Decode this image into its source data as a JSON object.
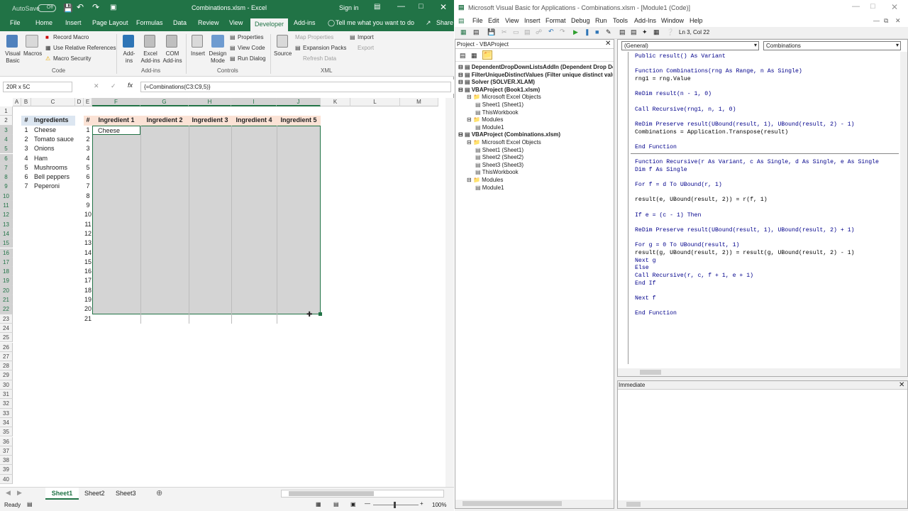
{
  "excel": {
    "autosave_label": "AutoSave",
    "autosave_state": "Off",
    "title": "Combinations.xlsm  -  Excel",
    "signin": "Sign in",
    "tabs": [
      "File",
      "Home",
      "Insert",
      "Page Layout",
      "Formulas",
      "Data",
      "Review",
      "View",
      "Developer",
      "Add-ins"
    ],
    "tell_me": "Tell me what you want to do",
    "share": "Share",
    "ribbon": {
      "visual_basic": "Visual Basic",
      "macros": "Macros",
      "record_macro": "Record Macro",
      "use_relative": "Use Relative References",
      "macro_security": "Macro Security",
      "group_code": "Code",
      "addins": "Add-ins",
      "excel_addins": "Excel Add-ins",
      "com_addins": "COM Add-ins",
      "group_addins": "Add-ins",
      "insert": "Insert",
      "design_mode": "Design Mode",
      "properties": "Properties",
      "view_code": "View Code",
      "run_dialog": "Run Dialog",
      "group_controls": "Controls",
      "source": "Source",
      "map_properties": "Map Properties",
      "expansion_packs": "Expansion Packs",
      "refresh_data": "Refresh Data",
      "import": "Import",
      "export": "Export",
      "group_xml": "XML"
    },
    "name_box": "20R x 5C",
    "formula": "{=Combinations(C3:C9,5)}",
    "columns": [
      "A",
      "B",
      "C",
      "D",
      "E",
      "F",
      "G",
      "H",
      "I",
      "J",
      "K",
      "L",
      "M"
    ],
    "ingredients_header": {
      "num": "#",
      "name": "Ingredients"
    },
    "ingredients": [
      {
        "num": "1",
        "name": "Cheese"
      },
      {
        "num": "2",
        "name": "Tomato sauce"
      },
      {
        "num": "3",
        "name": "Onions"
      },
      {
        "num": "4",
        "name": "Ham"
      },
      {
        "num": "5",
        "name": "Mushrooms"
      },
      {
        "num": "6",
        "name": "Bell peppers"
      },
      {
        "num": "7",
        "name": "Peperoni"
      }
    ],
    "combo_headers": [
      "#",
      "Ingredient 1",
      "Ingredient 2",
      "Ingredient 3",
      "Ingredient 4",
      "Ingredient 5"
    ],
    "combo_rows": [
      "1",
      "2",
      "3",
      "4",
      "5",
      "6",
      "7",
      "8",
      "9",
      "10",
      "11",
      "12",
      "13",
      "14",
      "15",
      "16",
      "17",
      "18",
      "19",
      "20",
      "21"
    ],
    "first_cell": "Cheese",
    "sheets": [
      "Sheet1",
      "Sheet2",
      "Sheet3"
    ],
    "status": "Ready",
    "zoom": "100%"
  },
  "vba": {
    "title": "Microsoft Visual Basic for Applications - Combinations.xlsm - [Module1 (Code)]",
    "menu": [
      "File",
      "Edit",
      "View",
      "Insert",
      "Format",
      "Debug",
      "Run",
      "Tools",
      "Add-Ins",
      "Window",
      "Help"
    ],
    "cursor_pos": "Ln 3, Col 22",
    "project_title": "Project - VBAProject",
    "tree": [
      {
        "label": "DependentDropDownListsAddIn (Dependent Drop Do",
        "level": 0,
        "bold": true
      },
      {
        "label": "FilterUniqueDistinctValues (Filter unique distinct valu",
        "level": 0,
        "bold": true
      },
      {
        "label": "Solver (SOLVER.XLAM)",
        "level": 0,
        "bold": true
      },
      {
        "label": "VBAProject (Book1.xlsm)",
        "level": 0,
        "bold": true
      },
      {
        "label": "Microsoft Excel Objects",
        "level": 1,
        "bold": false
      },
      {
        "label": "Sheet1 (Sheet1)",
        "level": 2,
        "bold": false
      },
      {
        "label": "ThisWorkbook",
        "level": 2,
        "bold": false
      },
      {
        "label": "Modules",
        "level": 1,
        "bold": false
      },
      {
        "label": "Module1",
        "level": 2,
        "bold": false
      },
      {
        "label": "VBAProject (Combinations.xlsm)",
        "level": 0,
        "bold": true
      },
      {
        "label": "Microsoft Excel Objects",
        "level": 1,
        "bold": false
      },
      {
        "label": "Sheet1 (Sheet1)",
        "level": 2,
        "bold": false
      },
      {
        "label": "Sheet2 (Sheet2)",
        "level": 2,
        "bold": false
      },
      {
        "label": "Sheet3 (Sheet3)",
        "level": 2,
        "bold": false
      },
      {
        "label": "ThisWorkbook",
        "level": 2,
        "bold": false
      },
      {
        "label": "Modules",
        "level": 1,
        "bold": false
      },
      {
        "label": "Module1",
        "level": 2,
        "bold": false
      }
    ],
    "object_dropdown": "(General)",
    "proc_dropdown": "Combinations",
    "code": [
      "Public result() As Variant",
      "",
      "Function Combinations(rng As Range, n As Single)",
      "rng1 = rng.Value",
      "",
      "ReDim result(n - 1, 0)",
      "",
      "Call Recursive(rng1, n, 1, 0)",
      "",
      "ReDim Preserve result(UBound(result, 1), UBound(result, 2) - 1)",
      "Combinations = Application.Transpose(result)",
      "",
      "End Function",
      "",
      "Function Recursive(r As Variant, c As Single, d As Single, e As Single",
      "Dim f As Single",
      "",
      "For f = d To UBound(r, 1)",
      "",
      "result(e, UBound(result, 2)) = r(f, 1)",
      "",
      "If e = (c - 1) Then",
      "",
      "ReDim Preserve result(UBound(result, 1), UBound(result, 2) + 1)",
      "",
      "For g = 0 To UBound(result, 1)",
      "result(g, UBound(result, 2)) = result(g, UBound(result, 2) - 1)",
      "Next g",
      "Else",
      "Call Recursive(r, c, f + 1, e + 1)",
      "End If",
      "",
      "Next f",
      "",
      "End Function"
    ],
    "immediate_title": "Immediate"
  }
}
